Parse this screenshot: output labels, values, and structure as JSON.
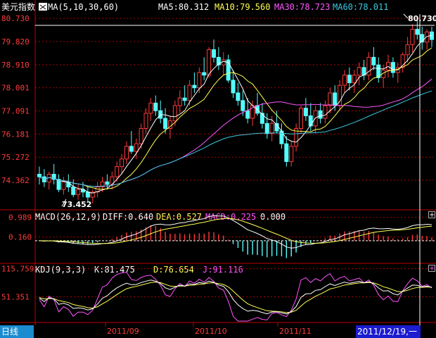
{
  "header": {
    "instrument": "美元指数",
    "ma_label": "MA(5,10,30,60)",
    "ma5_label": "MA5:80.312",
    "ma10_label": "MA10:79.560",
    "ma30_label": "MA30:78.723",
    "ma60_label": "MA60:78.011"
  },
  "macd_header": {
    "params": "MACD(26,12,9)",
    "diff": "DIFF:0.640",
    "dea": "DEA:0.527",
    "macd": "MACD:0.225",
    "zero": "0.000"
  },
  "kdj_header": {
    "params": "KDJ(9,3,3)",
    "k": "K:81.475",
    "d": "D:76.654",
    "j": "J:91.116"
  },
  "annotations": {
    "high": "80.730",
    "low": "73.452"
  },
  "footer": {
    "frequency": "日线",
    "cursor_date": "2011/12/19,一"
  },
  "buttons": {
    "plus": "+"
  },
  "colors": {
    "up": "#ff3b3b",
    "down": "#54ffff",
    "ma5": "#ffffff",
    "ma10": "#ffff54",
    "ma30": "#ff55ff",
    "ma60": "#3cc8e0",
    "grid": "#aa0000",
    "axis": "#c00000"
  },
  "chart_data": [
    {
      "type": "candlestick",
      "title": "美元指数",
      "y_ticks": [
        "80.730",
        "79.820",
        "78.910",
        "78.001",
        "77.091",
        "76.181",
        "75.272",
        "74.362"
      ],
      "ylim": [
        73.2,
        80.9
      ],
      "x_ticks": [
        "2011/09",
        "2011/10",
        "2011/11"
      ],
      "candles": [
        [
          74.6,
          74.9,
          74.2,
          74.5
        ],
        [
          74.5,
          74.8,
          74.1,
          74.3
        ],
        [
          74.3,
          74.7,
          74.0,
          74.6
        ],
        [
          74.6,
          75.0,
          74.2,
          74.4
        ],
        [
          74.4,
          74.6,
          73.9,
          74.0
        ],
        [
          74.0,
          74.5,
          73.8,
          74.3
        ],
        [
          74.3,
          74.6,
          73.9,
          74.1
        ],
        [
          74.1,
          74.4,
          73.7,
          73.8
        ],
        [
          73.8,
          74.2,
          73.6,
          74.0
        ],
        [
          74.0,
          74.3,
          73.7,
          73.9
        ],
        [
          73.9,
          74.1,
          73.5,
          73.7
        ],
        [
          73.7,
          74.0,
          73.45,
          73.9
        ],
        [
          73.9,
          74.3,
          73.7,
          74.1
        ],
        [
          74.1,
          74.5,
          73.9,
          74.3
        ],
        [
          74.3,
          74.6,
          74.0,
          74.2
        ],
        [
          74.2,
          74.7,
          74.0,
          74.5
        ],
        [
          74.5,
          75.1,
          74.3,
          74.9
        ],
        [
          74.9,
          75.4,
          74.6,
          75.2
        ],
        [
          75.2,
          75.9,
          75.0,
          75.7
        ],
        [
          75.7,
          76.3,
          75.4,
          75.5
        ],
        [
          75.5,
          76.0,
          75.2,
          75.8
        ],
        [
          75.8,
          76.6,
          75.6,
          76.4
        ],
        [
          76.4,
          77.2,
          76.2,
          77.0
        ],
        [
          77.0,
          77.6,
          76.7,
          77.4
        ],
        [
          77.4,
          77.7,
          76.9,
          77.1
        ],
        [
          77.1,
          77.5,
          76.6,
          76.8
        ],
        [
          76.8,
          77.2,
          76.2,
          76.4
        ],
        [
          76.4,
          76.9,
          76.0,
          76.7
        ],
        [
          76.7,
          77.5,
          76.5,
          77.3
        ],
        [
          77.3,
          77.9,
          77.0,
          77.6
        ],
        [
          77.6,
          78.1,
          77.3,
          77.5
        ],
        [
          77.5,
          78.3,
          77.3,
          78.1
        ],
        [
          78.1,
          78.6,
          77.8,
          78.0
        ],
        [
          78.0,
          78.8,
          77.8,
          78.6
        ],
        [
          78.6,
          79.2,
          78.3,
          78.5
        ],
        [
          78.5,
          79.6,
          78.4,
          79.5
        ],
        [
          79.5,
          79.9,
          79.0,
          79.2
        ],
        [
          79.2,
          79.6,
          78.7,
          78.9
        ],
        [
          78.9,
          79.4,
          78.5,
          79.1
        ],
        [
          79.1,
          79.3,
          78.2,
          78.3
        ],
        [
          78.3,
          78.7,
          77.6,
          77.8
        ],
        [
          77.8,
          78.2,
          77.3,
          77.5
        ],
        [
          77.5,
          77.9,
          76.9,
          77.1
        ],
        [
          77.1,
          77.6,
          76.6,
          76.8
        ],
        [
          76.8,
          77.5,
          76.5,
          77.3
        ],
        [
          77.3,
          77.8,
          76.9,
          77.0
        ],
        [
          77.0,
          77.4,
          76.4,
          76.6
        ],
        [
          76.6,
          77.0,
          76.0,
          76.2
        ],
        [
          76.2,
          76.9,
          75.9,
          76.6
        ],
        [
          76.6,
          77.1,
          76.2,
          76.3
        ],
        [
          76.3,
          76.6,
          75.6,
          75.8
        ],
        [
          75.8,
          76.1,
          74.9,
          75.1
        ],
        [
          75.1,
          75.9,
          74.9,
          75.7
        ],
        [
          75.7,
          76.6,
          75.5,
          76.4
        ],
        [
          76.4,
          77.3,
          76.2,
          77.2
        ],
        [
          77.2,
          77.6,
          76.7,
          76.9
        ],
        [
          76.9,
          77.4,
          76.3,
          76.5
        ],
        [
          76.5,
          77.3,
          76.2,
          77.1
        ],
        [
          77.1,
          77.4,
          76.6,
          76.8
        ],
        [
          76.8,
          77.5,
          76.6,
          77.3
        ],
        [
          77.3,
          78.0,
          77.0,
          77.8
        ],
        [
          77.8,
          78.1,
          77.1,
          77.3
        ],
        [
          77.3,
          78.3,
          77.1,
          78.1
        ],
        [
          78.1,
          78.7,
          77.8,
          78.5
        ],
        [
          78.5,
          78.8,
          77.9,
          78.2
        ],
        [
          78.2,
          78.7,
          77.8,
          78.5
        ],
        [
          78.5,
          79.0,
          78.1,
          78.8
        ],
        [
          78.8,
          79.1,
          78.3,
          78.5
        ],
        [
          78.5,
          79.4,
          78.3,
          79.2
        ],
        [
          79.2,
          79.6,
          78.7,
          78.9
        ],
        [
          78.9,
          79.2,
          78.2,
          78.4
        ],
        [
          78.4,
          78.9,
          78.0,
          78.7
        ],
        [
          78.7,
          79.3,
          78.4,
          79.0
        ],
        [
          79.0,
          79.2,
          78.4,
          78.6
        ],
        [
          78.6,
          79.0,
          78.2,
          78.8
        ],
        [
          78.8,
          79.4,
          78.6,
          79.3
        ],
        [
          79.3,
          80.0,
          79.0,
          79.7
        ],
        [
          79.7,
          80.5,
          79.4,
          80.3
        ],
        [
          80.3,
          80.73,
          79.9,
          80.1
        ],
        [
          80.1,
          80.4,
          79.5,
          79.8
        ],
        [
          79.8,
          80.3,
          79.5,
          80.2
        ],
        [
          80.2,
          80.4,
          79.6,
          79.9
        ]
      ]
    },
    {
      "type": "line",
      "title": "MACD(26,12,9)",
      "y_ticks": [
        "0.989",
        "0.160"
      ],
      "ylim": [
        -0.9,
        1.25
      ],
      "series": [
        {
          "name": "DIFF"
        },
        {
          "name": "DEA"
        },
        {
          "name": "MACD"
        }
      ]
    },
    {
      "type": "line",
      "title": "KDJ(9,3,3)",
      "y_ticks": [
        "115.759",
        "51.351"
      ],
      "ylim": [
        -5,
        125
      ],
      "series": [
        {
          "name": "K"
        },
        {
          "name": "D"
        },
        {
          "name": "J"
        }
      ]
    }
  ]
}
